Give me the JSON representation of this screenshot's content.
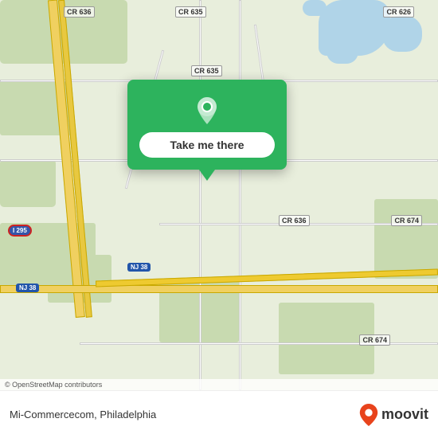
{
  "map": {
    "attribution": "© OpenStreetMap contributors",
    "popup": {
      "button_label": "Take me there"
    }
  },
  "bottom_bar": {
    "location_text": "Mi-Commercecom, Philadelphia",
    "logo_text": "moovit"
  },
  "road_labels": {
    "cr636_top": "CR 636",
    "cr635_top": "CR 635",
    "cr626": "CR 626",
    "cr635_mid": "CR 635",
    "cr636_mid": "CR 636",
    "cr674_top": "CR 674",
    "cr674_bot": "CR 674",
    "nj38_left": "NJ 38",
    "nj38_mid": "NJ 38",
    "i295": "I 295"
  }
}
